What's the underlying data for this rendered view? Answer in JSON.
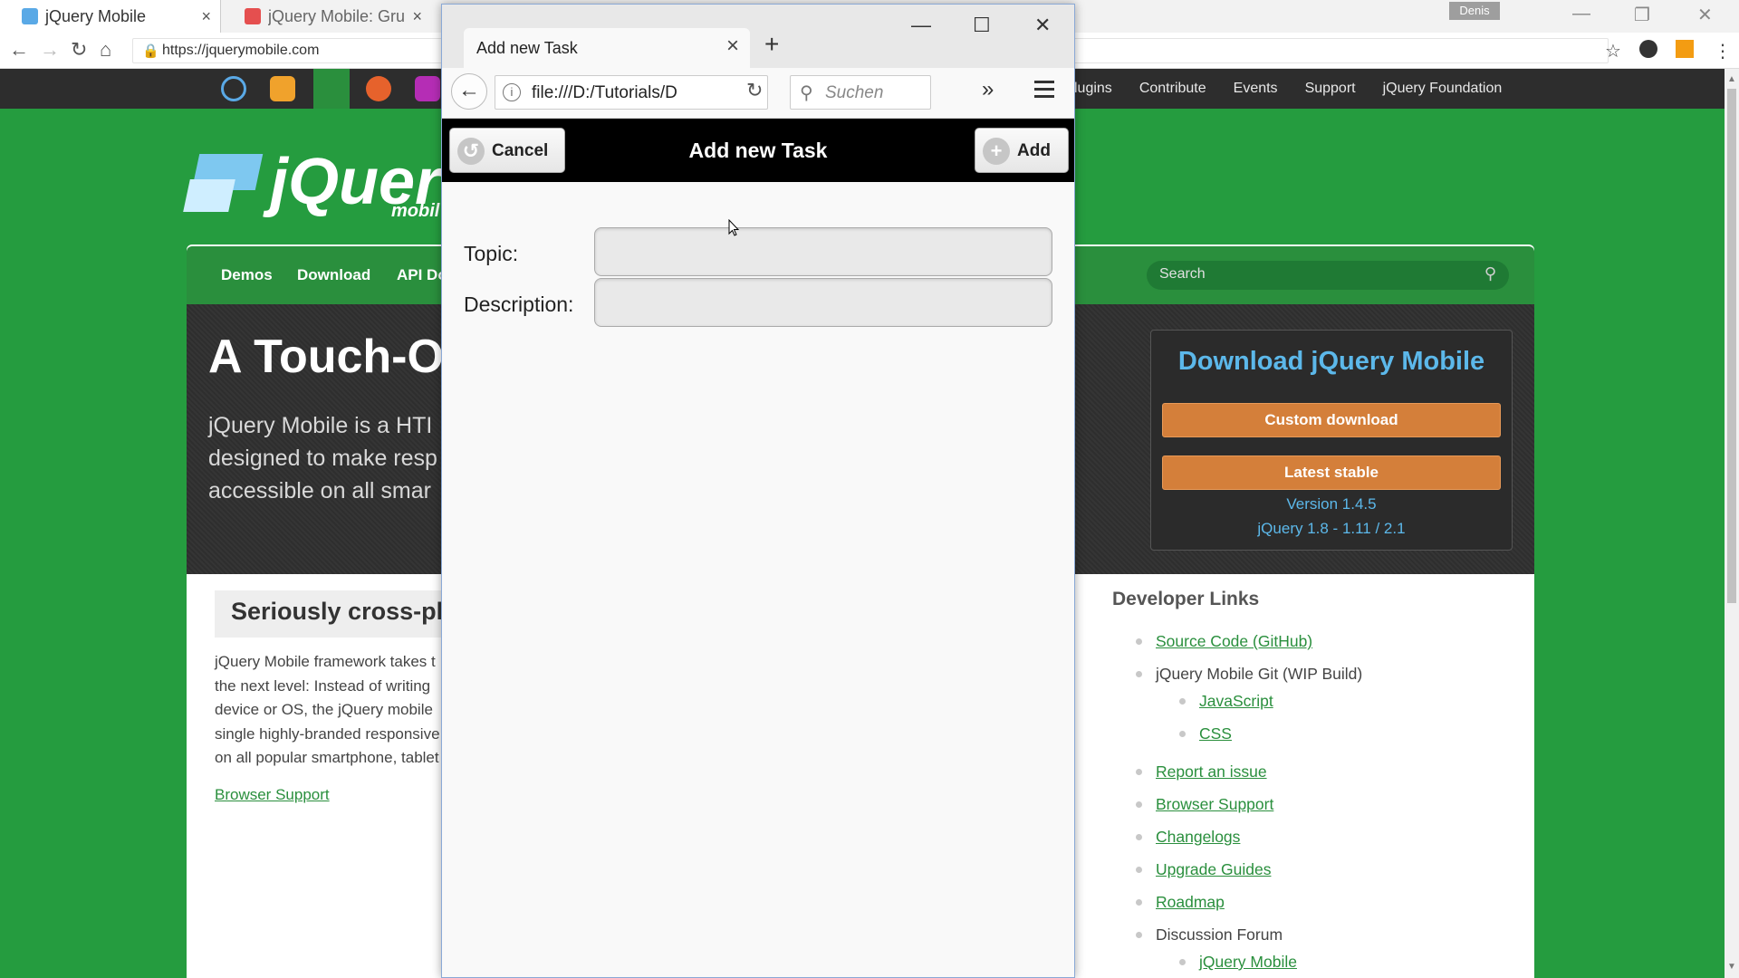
{
  "chrome": {
    "tabs": [
      {
        "label": "jQuery Mobile",
        "close": "×"
      },
      {
        "label": "jQuery Mobile: Gru",
        "close": "×"
      }
    ],
    "user_badge": "Denis",
    "url": "https://jquerymobile.com",
    "top_nav": [
      "lugins",
      "Contribute",
      "Events",
      "Support",
      "jQuery Foundation"
    ]
  },
  "site": {
    "logo_text": "jQuer",
    "logo_sub": "mobil",
    "menu": [
      "Demos",
      "Download",
      "API Do"
    ],
    "search_placeholder": "Search",
    "hero_title": "A Touch-O",
    "hero_text": "jQuery Mobile is a HTI designed to make resp accessible on all smar",
    "download": {
      "title": "Download jQuery Mobile",
      "custom_label": "Custom download",
      "stable_label": "Latest stable",
      "version": "Version 1.4.5",
      "jquery": "jQuery 1.8 - 1.11 / 2.1"
    },
    "cross": {
      "title": "Seriously cross-plat",
      "text": "jQuery Mobile framework takes t the next level: Instead of writing device or OS, the jQuery mobile single highly-branded responsive on all popular smartphone, tablet",
      "link": "Browser Support"
    },
    "developer_links": {
      "title": "Developer Links",
      "items": [
        {
          "label": "Source Code (GitHub)"
        },
        {
          "label": "jQuery Mobile Git (WIP Build)"
        },
        {
          "label": "JavaScript"
        },
        {
          "label": "CSS"
        },
        {
          "label": "Report an issue"
        },
        {
          "label": "Browser Support"
        },
        {
          "label": "Changelogs"
        },
        {
          "label": "Upgrade Guides"
        },
        {
          "label": "Roadmap"
        },
        {
          "label": "Discussion Forum"
        },
        {
          "label": "jQuery Mobile"
        }
      ]
    }
  },
  "firefox": {
    "tab_title": "Add new Task",
    "tab_close": "×",
    "new_tab": "+",
    "url": "file:///D:/Tutorials/D",
    "search_placeholder": "Suchen",
    "overflow": "»"
  },
  "app": {
    "title": "Add new Task",
    "cancel_label": "Cancel",
    "add_label": "Add",
    "topic_label": "Topic:",
    "topic_value": "",
    "description_label": "Description:",
    "description_value": ""
  }
}
